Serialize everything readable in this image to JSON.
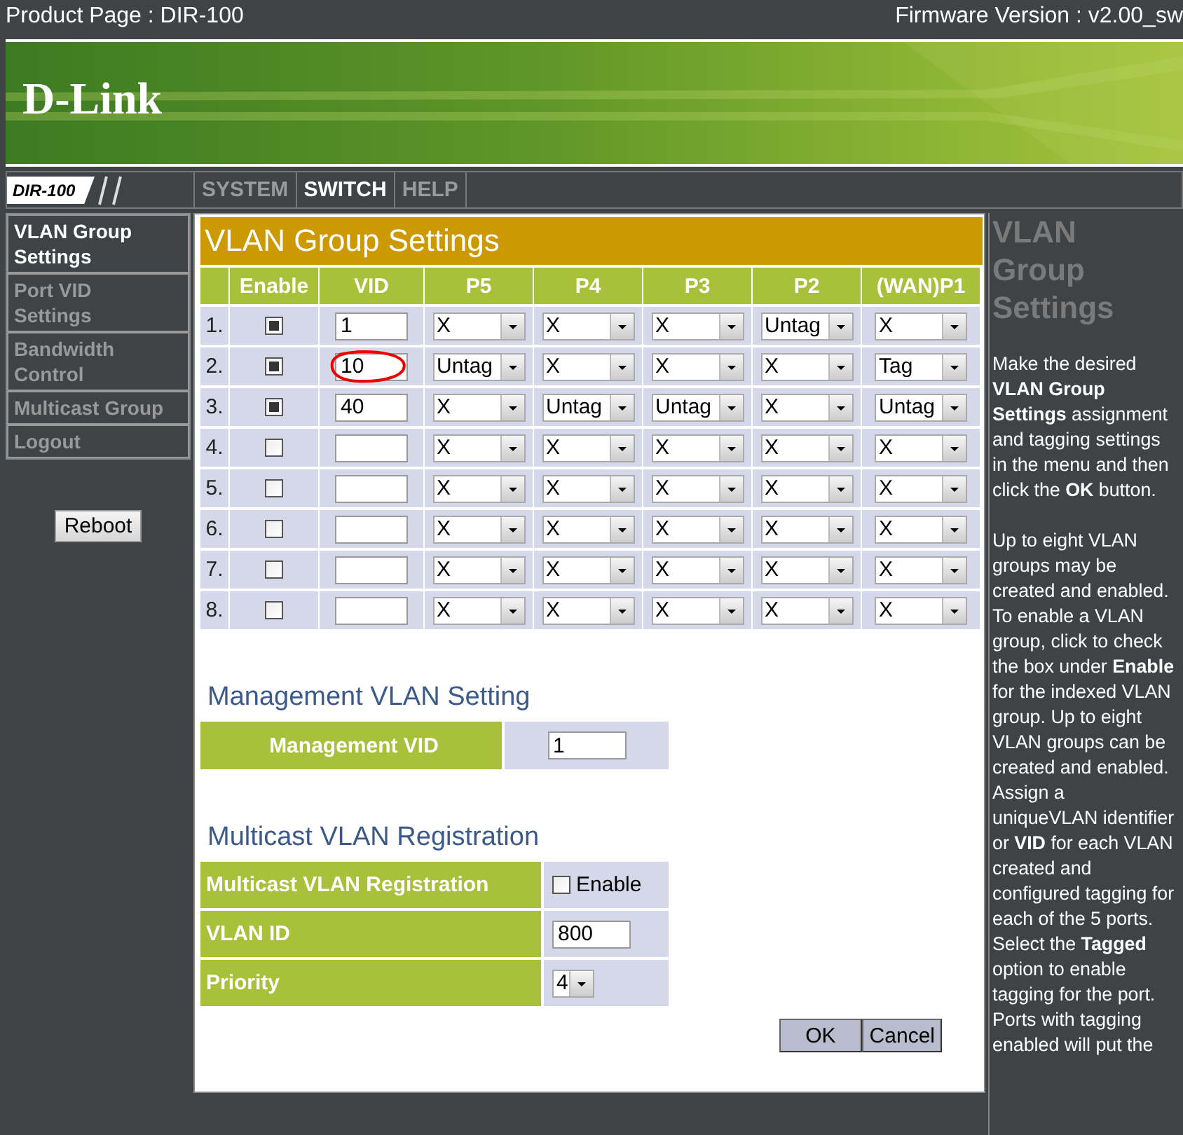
{
  "top_bar": {
    "product": "Product Page : DIR-100",
    "firmware": "Firmware Version : v2.00_sw"
  },
  "banner": {
    "logo": "D-Link"
  },
  "nav": {
    "model": "DIR-100",
    "tabs": [
      {
        "label": "SYSTEM",
        "selected": false
      },
      {
        "label": "SWITCH",
        "selected": true
      },
      {
        "label": "HELP",
        "selected": false
      }
    ]
  },
  "sidebar": {
    "items": [
      {
        "label": "VLAN Group Settings",
        "selected": true
      },
      {
        "label": "Port VID Settings",
        "selected": false
      },
      {
        "label": "Bandwidth Control",
        "selected": false
      },
      {
        "label": "Multicast Group",
        "selected": false
      },
      {
        "label": "Logout",
        "selected": false
      }
    ],
    "reboot": "Reboot"
  },
  "vlan_groups": {
    "title": "VLAN Group Settings",
    "columns": [
      "Enable",
      "VID",
      "P5",
      "P4",
      "P3",
      "P2",
      "(WAN)P1"
    ],
    "rows": [
      {
        "index": "1.",
        "enabled": true,
        "vid": "1",
        "ports": [
          "X",
          "X",
          "X",
          "Untag",
          "X"
        ],
        "circled": false
      },
      {
        "index": "2.",
        "enabled": true,
        "vid": "10",
        "ports": [
          "Untag",
          "X",
          "X",
          "X",
          "Tag"
        ],
        "circled": true
      },
      {
        "index": "3.",
        "enabled": true,
        "vid": "40",
        "ports": [
          "X",
          "Untag",
          "Untag",
          "X",
          "Untag"
        ],
        "circled": false
      },
      {
        "index": "4.",
        "enabled": false,
        "vid": "",
        "ports": [
          "X",
          "X",
          "X",
          "X",
          "X"
        ],
        "circled": false
      },
      {
        "index": "5.",
        "enabled": false,
        "vid": "",
        "ports": [
          "X",
          "X",
          "X",
          "X",
          "X"
        ],
        "circled": false
      },
      {
        "index": "6.",
        "enabled": false,
        "vid": "",
        "ports": [
          "X",
          "X",
          "X",
          "X",
          "X"
        ],
        "circled": false
      },
      {
        "index": "7.",
        "enabled": false,
        "vid": "",
        "ports": [
          "X",
          "X",
          "X",
          "X",
          "X"
        ],
        "circled": false
      },
      {
        "index": "8.",
        "enabled": false,
        "vid": "",
        "ports": [
          "X",
          "X",
          "X",
          "X",
          "X"
        ],
        "circled": false
      }
    ]
  },
  "management": {
    "title": "Management VLAN Setting",
    "label": "Management VID",
    "value": "1"
  },
  "multicast": {
    "title": "Multicast VLAN Registration",
    "rows": [
      {
        "kind": "checkbox",
        "label": "Multicast VLAN Registration",
        "option": "Enable",
        "checked": false
      },
      {
        "kind": "input",
        "label": "VLAN ID",
        "value": "800"
      },
      {
        "kind": "select",
        "label": "Priority",
        "value": "4"
      }
    ]
  },
  "buttons": [
    "OK",
    "Cancel"
  ],
  "help": {
    "title": "VLAN Group Settings",
    "paragraphs": [
      "Make the desired **VLAN Group Settings** assignment and tagging settings in the menu and then click the **OK** button.",
      "Up to eight VLAN groups may be created and enabled. To enable a VLAN group, click to check the box under **Enable** for the indexed VLAN group. Up to eight VLAN groups can be created and enabled. Assign a uniqueVLAN identifier or **VID** for each VLAN created and configured tagging for each of the 5 ports. Select the **Tagged** option to enable tagging for the port. Ports with tagging enabled will put the"
    ]
  }
}
